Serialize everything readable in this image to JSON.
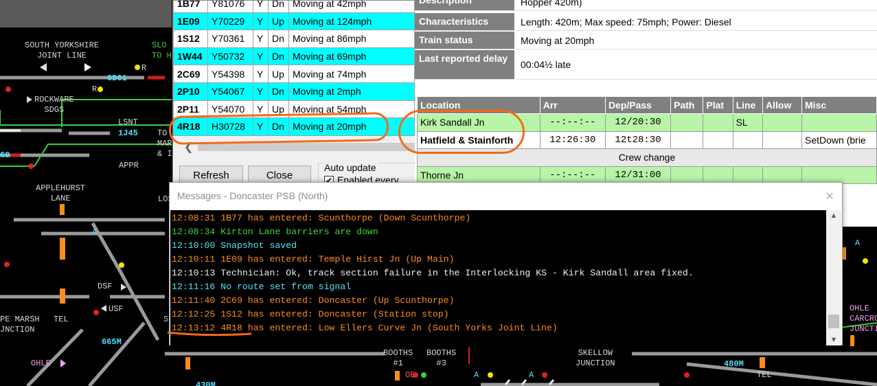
{
  "diagram": {
    "labels": {
      "south_yorkshire": "SOUTH YORKSHIRE\nJOINT LINE",
      "slot": "SLO\nTO H",
      "rockware": "ROCKWARE\nSDGS",
      "lsnt": "LSNT",
      "to_mar": "TO\nMAR\n& I",
      "appr": "APPR",
      "applehurst": "APPLEHURST\nLANE",
      "los": "LOS",
      "dsf": "DSF",
      "usf": "USF",
      "marsh": "PE MARSH\nJNCTION",
      "tel_left": "TEL",
      "booths1": "BOOTHS\n#1",
      "booths3": "BOOTHS\n#3",
      "skellow": "SKELLOW\nJUNCTION",
      "tel_right": "TEL",
      "ohle_right": "OHLE\nCARCROF\nJUNCTION",
      "ohle_left": "OHLE",
      "six": "6D61",
      "one_j": "1J45",
      "sixty_nine": "69",
      "six_six_five": "665M",
      "four_eight_zero": "480M",
      "four_three_zero": "430M",
      "r1": "R",
      "r2": "R",
      "a1": "A",
      "a2": "A",
      "a3": "A",
      "a4": "A",
      "oe": "OE",
      "s_small": "S"
    }
  },
  "train_list": {
    "rows": [
      {
        "headcode": "1B77",
        "id": "Y81076",
        "flag": "Y",
        "dir": "Dn",
        "status": "Moving at 42mph",
        "style": "white"
      },
      {
        "headcode": "1E09",
        "id": "Y70229",
        "flag": "Y",
        "dir": "Up",
        "status": "Moving at 124mph",
        "style": "cyan"
      },
      {
        "headcode": "1S12",
        "id": "Y70361",
        "flag": "Y",
        "dir": "Dn",
        "status": "Moving at 86mph",
        "style": "white"
      },
      {
        "headcode": "1W44",
        "id": "Y50732",
        "flag": "Y",
        "dir": "Dn",
        "status": "Moving at 69mph",
        "style": "cyan"
      },
      {
        "headcode": "2C69",
        "id": "Y54398",
        "flag": "Y",
        "dir": "Up",
        "status": "Moving at 74mph",
        "style": "white"
      },
      {
        "headcode": "2P10",
        "id": "Y54067",
        "flag": "Y",
        "dir": "Dn",
        "status": "Moving at 2mph",
        "style": "cyan"
      },
      {
        "headcode": "2P11",
        "id": "Y54070",
        "flag": "Y",
        "dir": "Up",
        "status": "Moving at 54mph",
        "style": "white"
      },
      {
        "headcode": "4R18",
        "id": "H30728",
        "flag": "Y",
        "dir": "Dn",
        "status": "Moving at 20mph",
        "style": "sel"
      }
    ],
    "refresh_label": "Refresh",
    "close_label": "Close",
    "auto_update_legend": "Auto update",
    "enabled_label": "Enabled every",
    "enabled_checked": true
  },
  "train_details": {
    "description_key": "Description",
    "description_val": "Hopper 420m)",
    "characteristics_key": "Characteristics",
    "characteristics_val": "Length: 420m; Max speed: 75mph; Power: Diesel",
    "status_key": "Train status",
    "status_val": "Moving at 20mph",
    "delay_key": "Last reported delay",
    "delay_val": "00:04½ late",
    "timetable_headers": [
      "Location",
      "Arr",
      "Dep/Pass",
      "Path",
      "Plat",
      "Line",
      "Allow",
      "Misc"
    ],
    "timetable_rows": [
      {
        "location": "Kirk Sandall Jn",
        "arr": "--:--:--",
        "dep": "12/20:30",
        "path": "",
        "plat": "",
        "line": "SL",
        "allow": "",
        "misc": "",
        "style": "g"
      },
      {
        "location": "Hatfield & Stainforth",
        "arr": "12:26:30",
        "dep": "12t28:30",
        "path": "",
        "plat": "",
        "line": "",
        "allow": "",
        "misc": "SetDown (brie",
        "style": "w",
        "bold": true
      }
    ],
    "crew_change": "Crew change",
    "timetable_rows_after": [
      {
        "location": "Thorne Jn",
        "arr": "--:--:--",
        "dep": "12/31:00",
        "path": "",
        "plat": "",
        "line": "",
        "allow": "",
        "misc": "",
        "style": "g"
      }
    ]
  },
  "messages": {
    "title": "Messages - Doncaster PSB (North)",
    "close_label": "✕",
    "lines": [
      {
        "time": "12:08:31",
        "text": "1B77 has entered: Scunthorpe (Down Scunthorpe)",
        "color": "orange"
      },
      {
        "time": "12:08:34",
        "text": "Kirton Lane barriers are down",
        "color": "green"
      },
      {
        "time": "12:10:00",
        "text": "Snapshot saved",
        "color": "cyan"
      },
      {
        "time": "12:10:11",
        "text": "1E09 has entered: Temple Hirst Jn (Up Main)",
        "color": "orange"
      },
      {
        "time": "12:10:13",
        "text": "Technician: Ok, track section failure in the Interlocking KS - Kirk Sandall area fixed.",
        "color": "white"
      },
      {
        "time": "12:11:16",
        "text": "No route set from signal",
        "color": "cyan"
      },
      {
        "time": "12:11:40",
        "text": "2C69 has entered: Doncaster (Up Scunthorpe)",
        "color": "orange"
      },
      {
        "time": "12:12:25",
        "text": "1S12 has entered: Doncaster (Station stop)",
        "color": "orange"
      },
      {
        "time": "12:13:12",
        "text": "4R18 has entered: Low Ellers Curve Jn (South Yorks Joint Line)",
        "color": "orange"
      }
    ]
  }
}
